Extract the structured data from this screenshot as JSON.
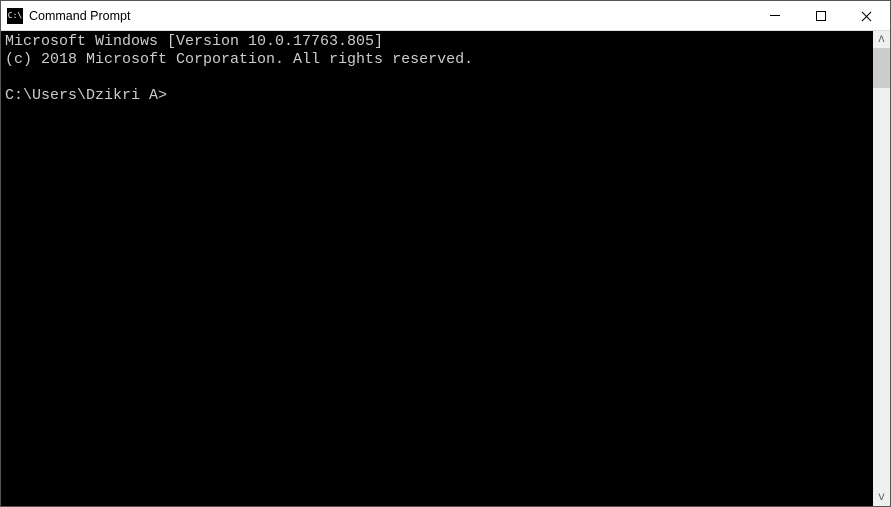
{
  "window": {
    "title": "Command Prompt",
    "icon_label": "C:\\"
  },
  "terminal": {
    "line1_version": "Microsoft Windows [Version 10.0.17763.805]",
    "line2_copyright": "(c) 2018 Microsoft Corporation. All rights reserved.",
    "blank": "",
    "prompt": "C:\\Users\\Dzikri A>"
  }
}
